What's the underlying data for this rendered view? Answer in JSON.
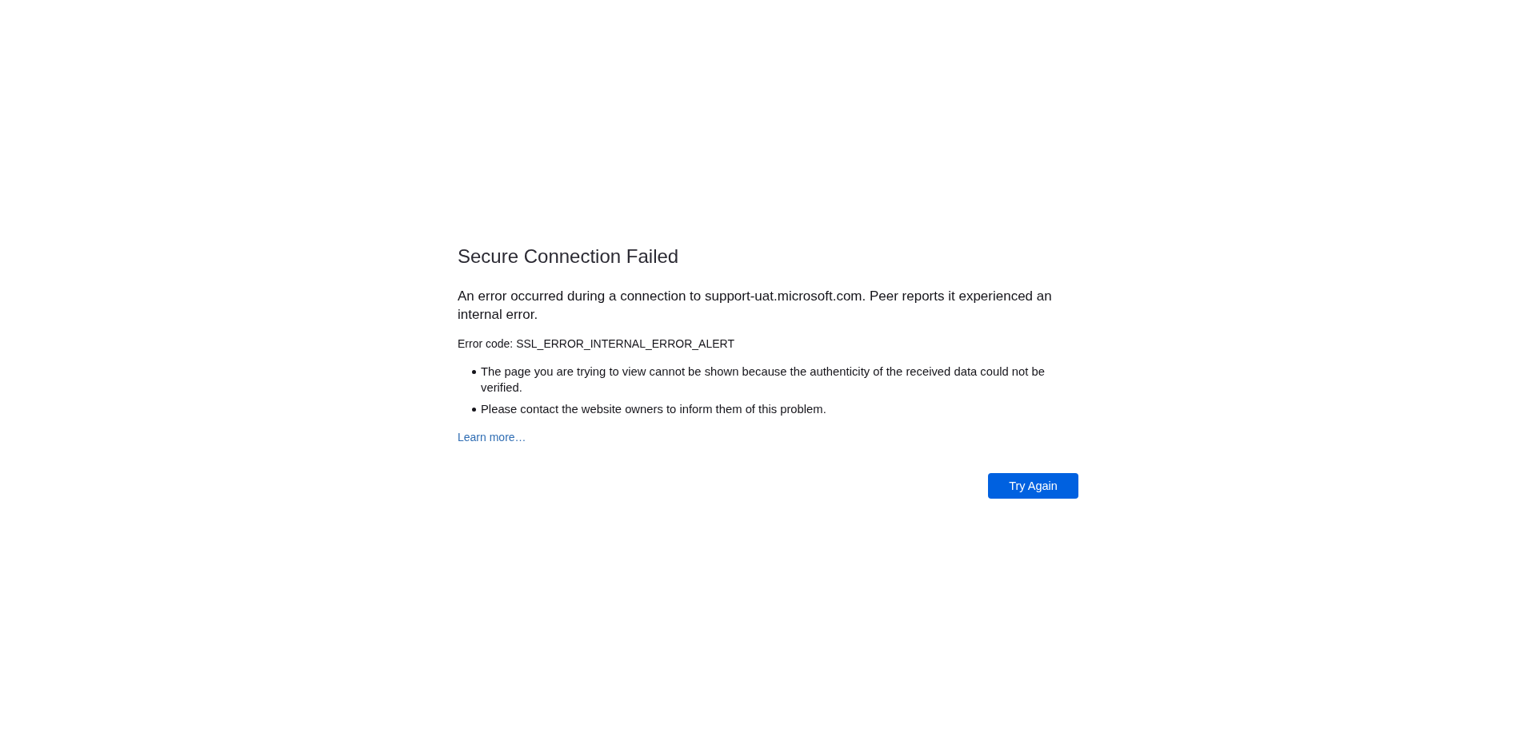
{
  "page": {
    "title": "Secure Connection Failed",
    "message": "An error occurred during a connection to support-uat.microsoft.com. Peer reports it experienced an internal error.",
    "error_code": "Error code: SSL_ERROR_INTERNAL_ERROR_ALERT",
    "details": [
      "The page you are trying to view cannot be shown because the authenticity of the received data could not be verified.",
      "Please contact the website owners to inform them of this problem."
    ],
    "learn_more_link": "Learn more…",
    "buttons": [
      "Try Again"
    ]
  }
}
